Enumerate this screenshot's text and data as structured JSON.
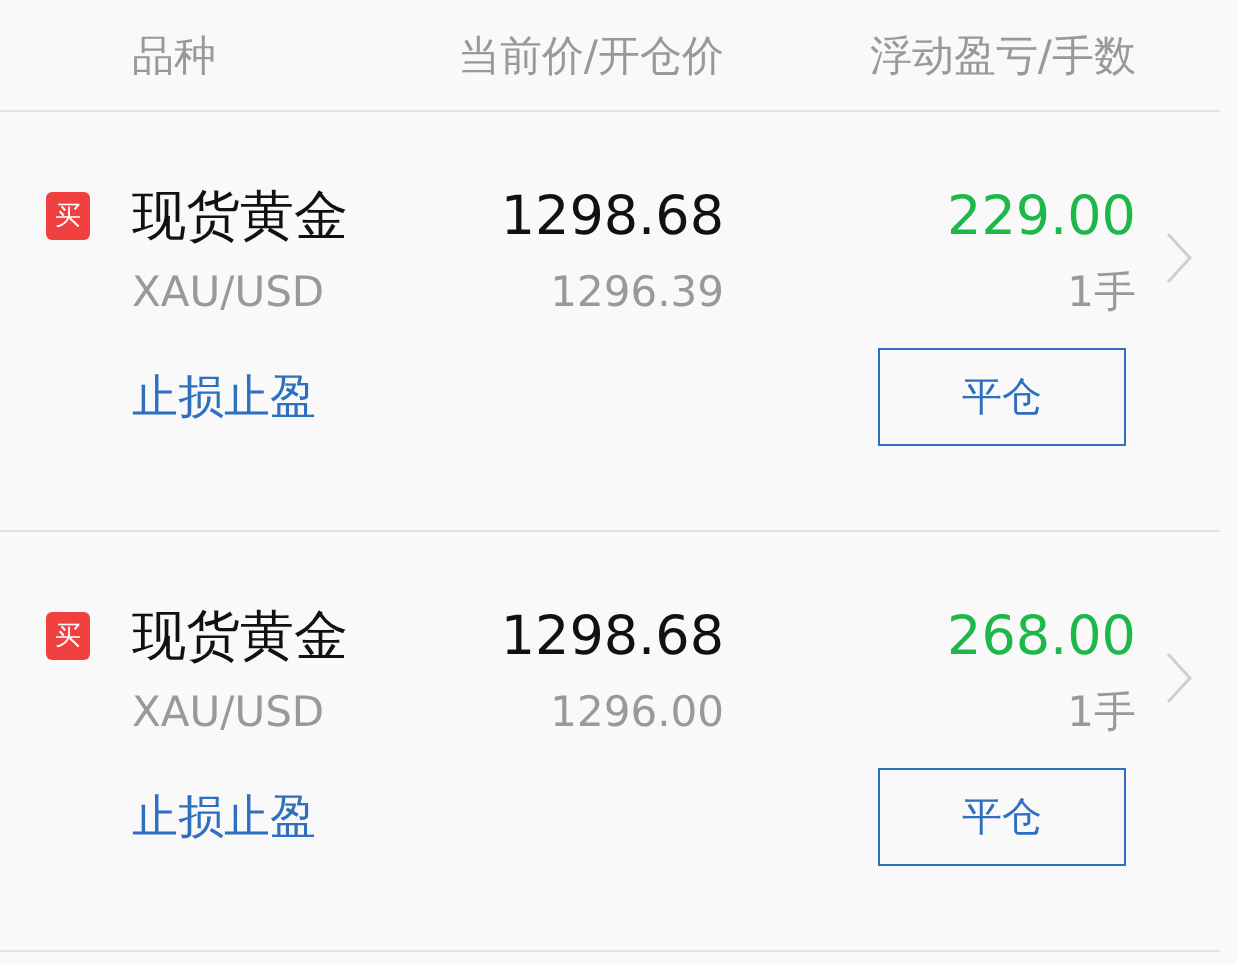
{
  "header": {
    "columns": [
      "品种",
      "当前价/开仓价",
      "浮动盈亏/手数"
    ]
  },
  "positions": [
    {
      "kind": "buy",
      "badge": "买",
      "name": "现货黄金",
      "symbol": "XAU/USD",
      "current_price": "1298.68",
      "open_price": "1296.39",
      "pnl": "229.00",
      "lots": "1手",
      "stop_link": "止损止盈",
      "close_button": "平仓"
    },
    {
      "kind": "buy",
      "badge": "买",
      "name": "现货黄金",
      "symbol": "XAU/USD",
      "current_price": "1298.68",
      "open_price": "1296.00",
      "pnl": "268.00",
      "lots": "1手",
      "stop_link": "止损止盈",
      "close_button": "平仓"
    }
  ]
}
